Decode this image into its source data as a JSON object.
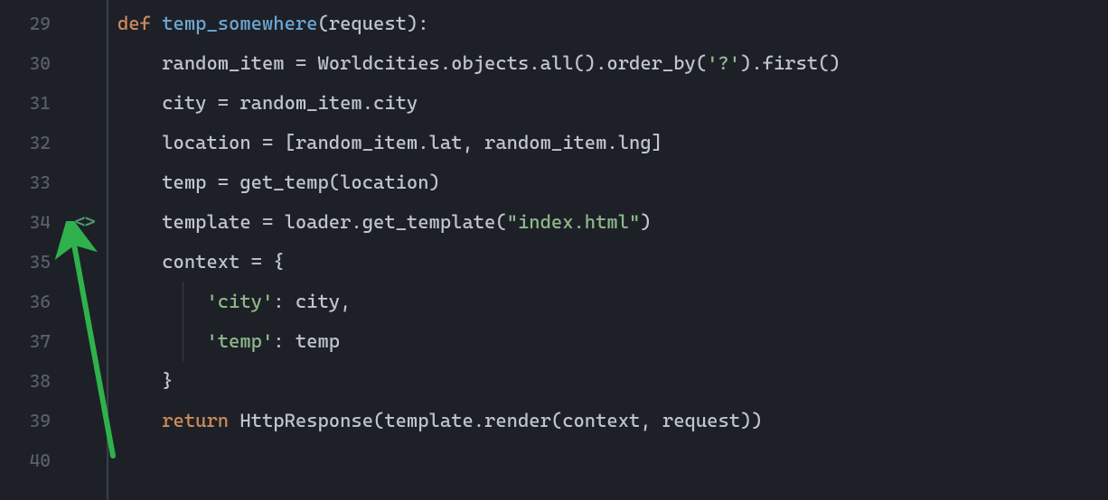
{
  "editor": {
    "lines": [
      {
        "num": "29",
        "marker": "",
        "tokens": [
          {
            "cls": "tok-kw",
            "t": "def "
          },
          {
            "cls": "tok-fn",
            "t": "temp_somewhere"
          },
          {
            "cls": "tok-punct",
            "t": "("
          },
          {
            "cls": "tok-plain",
            "t": "request"
          },
          {
            "cls": "tok-punct",
            "t": "):"
          }
        ],
        "indent": 0
      },
      {
        "num": "30",
        "marker": "",
        "tokens": [
          {
            "cls": "tok-plain",
            "t": "    random_item = Worldcities.objects.all().order_by("
          },
          {
            "cls": "tok-str",
            "t": "'?'"
          },
          {
            "cls": "tok-plain",
            "t": ").first()"
          }
        ],
        "indent": 1
      },
      {
        "num": "31",
        "marker": "",
        "tokens": [
          {
            "cls": "tok-plain",
            "t": "    city = random_item.city"
          }
        ],
        "indent": 1
      },
      {
        "num": "32",
        "marker": "",
        "tokens": [
          {
            "cls": "tok-plain",
            "t": "    location = [random_item.lat, random_item.lng]"
          }
        ],
        "indent": 1
      },
      {
        "num": "33",
        "marker": "",
        "tokens": [
          {
            "cls": "tok-plain",
            "t": "    temp = get_temp(location)"
          }
        ],
        "indent": 1
      },
      {
        "num": "34",
        "marker": "<>",
        "tokens": [
          {
            "cls": "tok-plain",
            "t": "    template = loader.get_template("
          },
          {
            "cls": "tok-str",
            "t": "\"index.html\""
          },
          {
            "cls": "tok-plain",
            "t": ")"
          }
        ],
        "indent": 1
      },
      {
        "num": "35",
        "marker": "",
        "tokens": [
          {
            "cls": "tok-plain",
            "t": "    context = {"
          }
        ],
        "indent": 1
      },
      {
        "num": "36",
        "marker": "",
        "tokens": [
          {
            "cls": "tok-plain",
            "t": "        "
          },
          {
            "cls": "tok-str",
            "t": "'city'"
          },
          {
            "cls": "tok-plain",
            "t": ": city,"
          }
        ],
        "indent": 2
      },
      {
        "num": "37",
        "marker": "",
        "tokens": [
          {
            "cls": "tok-plain",
            "t": "        "
          },
          {
            "cls": "tok-str",
            "t": "'temp'"
          },
          {
            "cls": "tok-plain",
            "t": ": temp"
          }
        ],
        "indent": 2
      },
      {
        "num": "38",
        "marker": "",
        "tokens": [
          {
            "cls": "tok-plain",
            "t": "    }"
          }
        ],
        "indent": 1
      },
      {
        "num": "39",
        "marker": "",
        "tokens": [
          {
            "cls": "tok-plain",
            "t": "    "
          },
          {
            "cls": "tok-kw",
            "t": "return"
          },
          {
            "cls": "tok-plain",
            "t": " HttpResponse(template.render(context, request))"
          }
        ],
        "indent": 1
      },
      {
        "num": "40",
        "marker": "",
        "tokens": [],
        "indent": 0
      }
    ]
  },
  "annotation": {
    "arrow_color": "#2fb24c"
  }
}
